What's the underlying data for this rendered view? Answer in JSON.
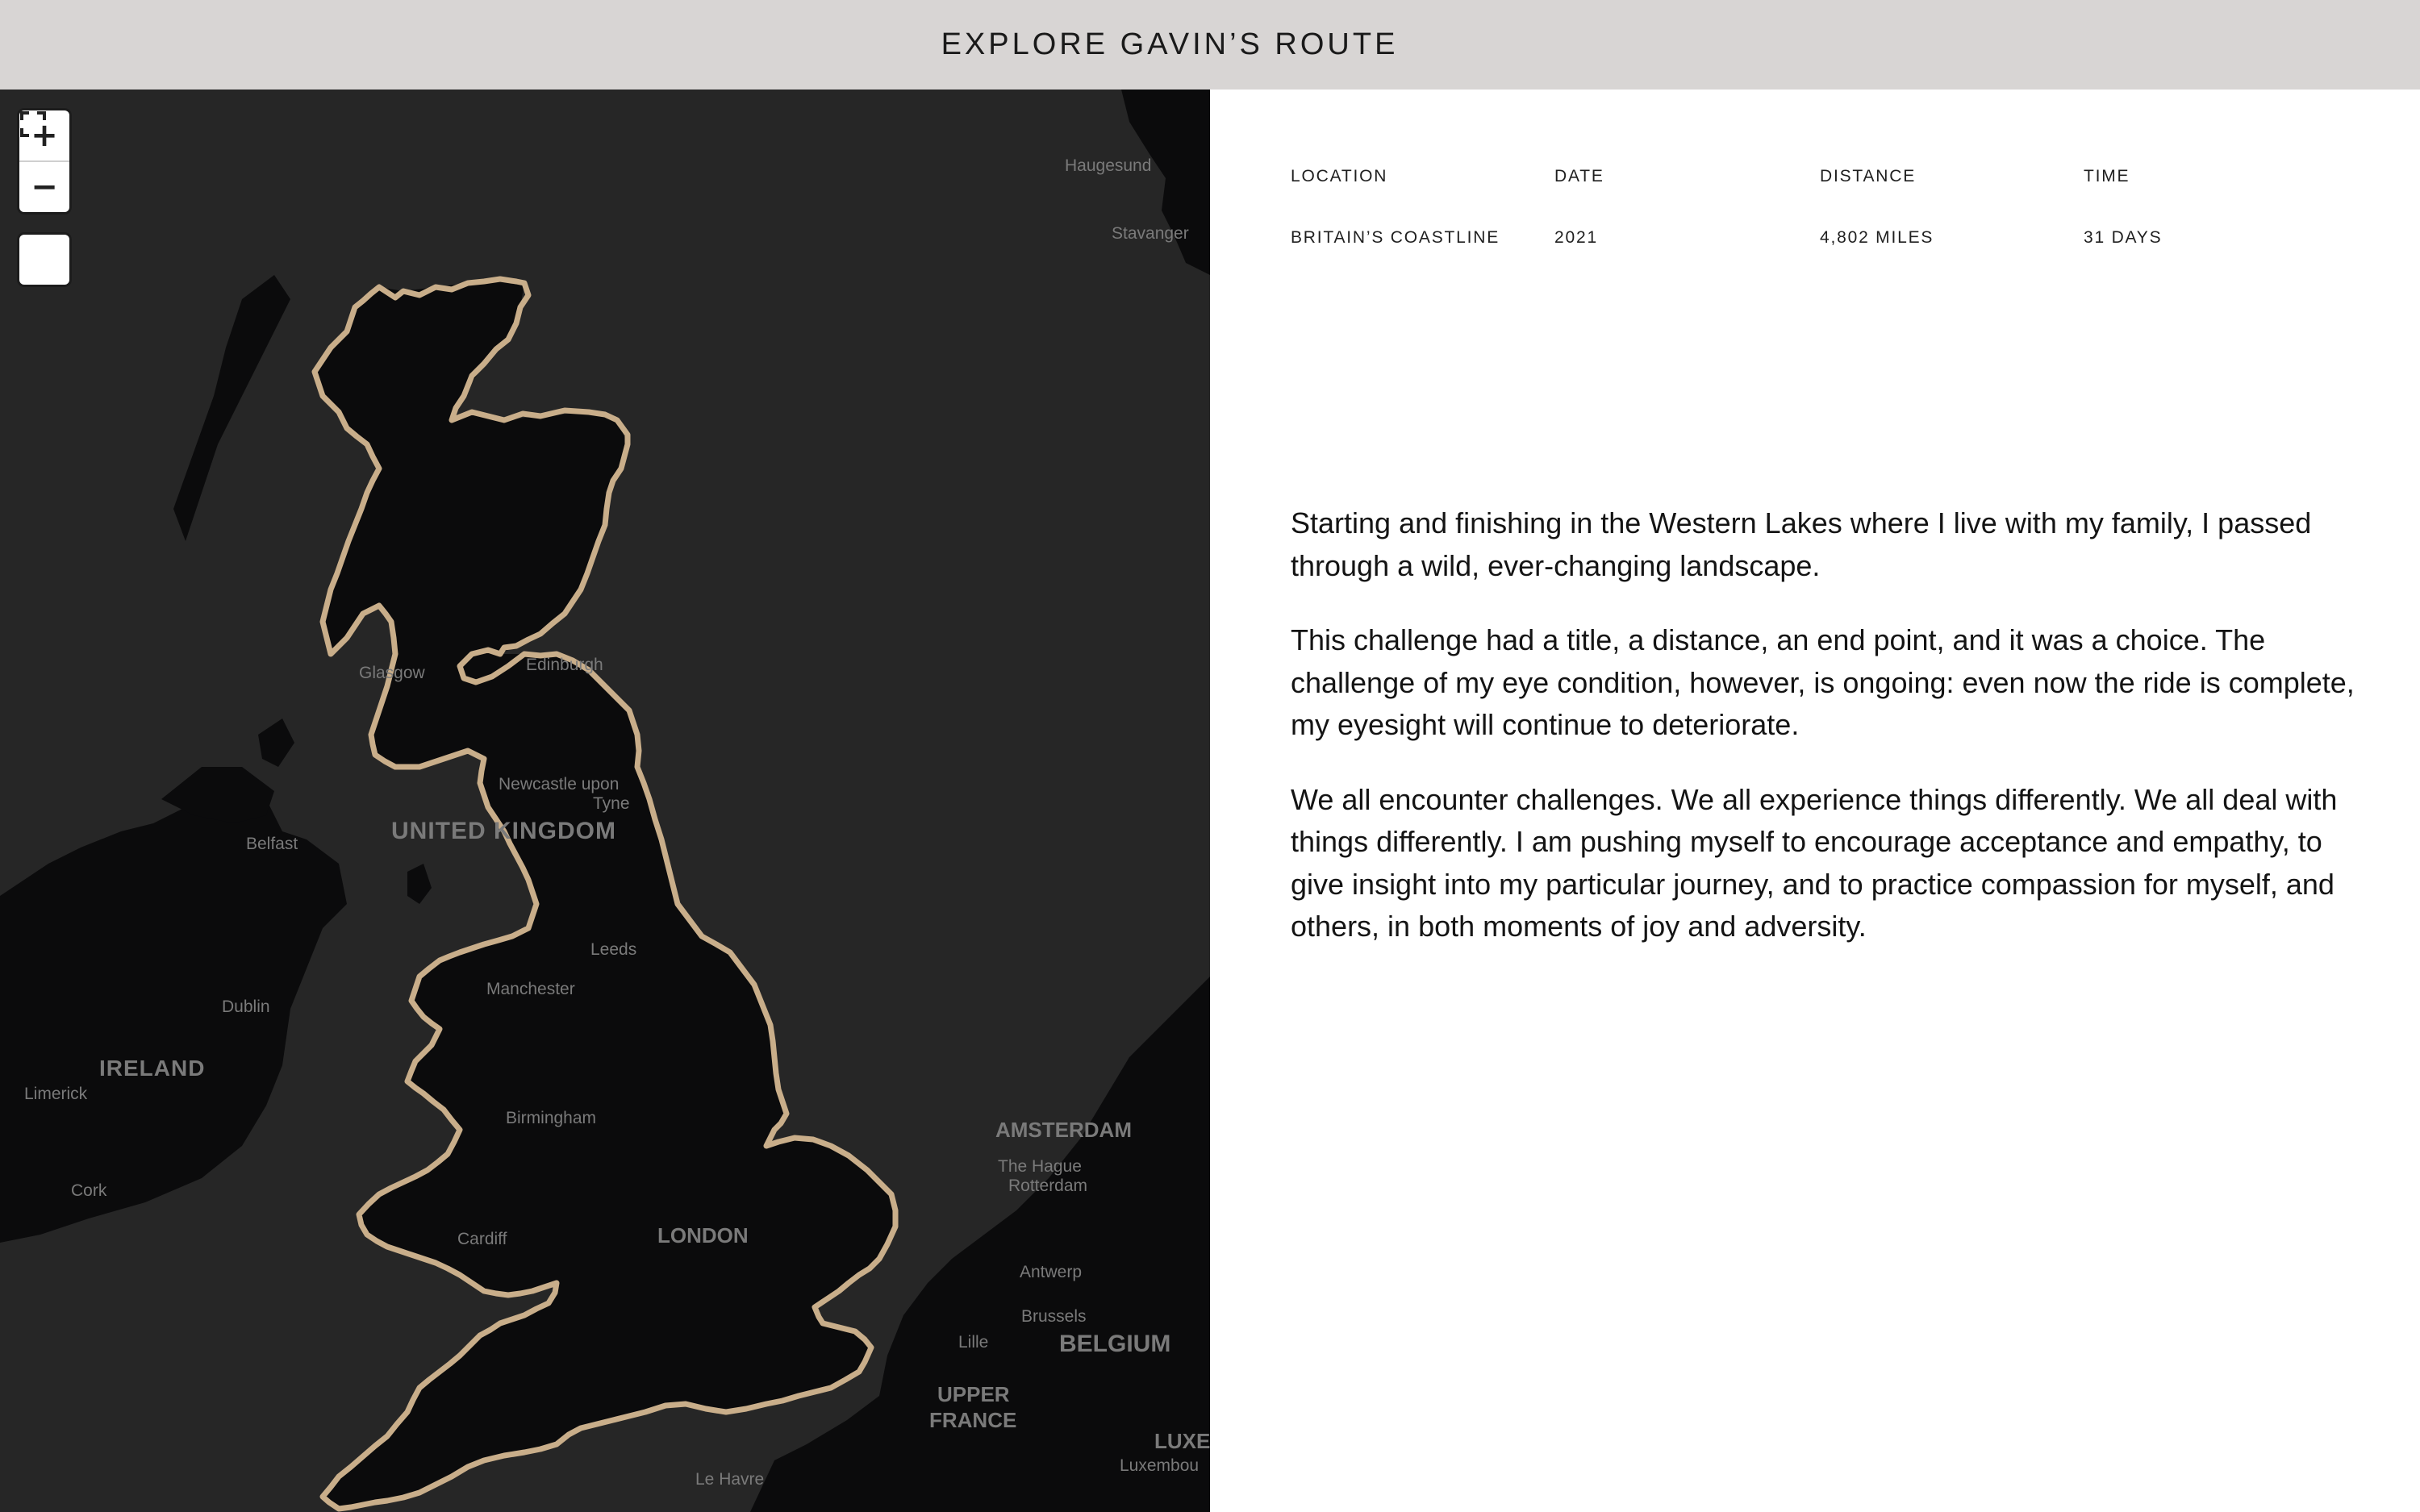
{
  "header": {
    "title": "EXPLORE GAVIN’S ROUTE"
  },
  "map": {
    "controls": {
      "zoom_in": "+",
      "zoom_out": "−",
      "fullscreen_icon": "fullscreen-icon"
    },
    "colors": {
      "land": "#0b0b0c",
      "sea": "#262626",
      "route": "#c9ae8a"
    },
    "labels": {
      "haugesund": "Haugesund",
      "stavanger": "Stavanger",
      "glasgow": "Glasgow",
      "edinburgh": "Edinburgh",
      "newcastle_1": "Newcastle upon",
      "newcastle_2": "Tyne",
      "united_kingdom": "UNITED KINGDOM",
      "belfast": "Belfast",
      "leeds": "Leeds",
      "manchester": "Manchester",
      "dublin": "Dublin",
      "ireland": "IRELAND",
      "limerick": "Limerick",
      "cork": "Cork",
      "birmingham": "Birmingham",
      "amsterdam": "AMSTERDAM",
      "the_hague": "The Hague",
      "rotterdam": "Rotterdam",
      "cardiff": "Cardiff",
      "london": "LONDON",
      "antwerp": "Antwerp",
      "brussels": "Brussels",
      "lille": "Lille",
      "belgium": "BELGIUM",
      "upper_france_1": "UPPER",
      "upper_france_2": "FRANCE",
      "luxe": "LUXE",
      "luxembou": "Luxembou",
      "le_havre": "Le Havre"
    }
  },
  "stats": {
    "location": {
      "label": "LOCATION",
      "value": "BRITAIN’S COASTLINE"
    },
    "date": {
      "label": "DATE",
      "value": "2021"
    },
    "distance": {
      "label": "DISTANCE",
      "value": "4,802 MILES"
    },
    "time": {
      "label": "TIME",
      "value": "31 DAYS"
    }
  },
  "body": {
    "p1": "Starting and finishing in the Western Lakes where I live with my family, I passed through a wild, ever-changing landscape.",
    "p2": "This challenge had a title, a distance, an end point, and it was a choice. The challenge of my eye condition, however, is ongoing: even now the ride is complete, my eyesight will continue to deteriorate.",
    "p3": "We all encounter challenges. We all experience things differently. We all deal with things differently. I am pushing myself to encourage acceptance and empathy, to give insight into my particular journey, and to practice compassion for myself, and others, in both moments of joy and adversity."
  }
}
